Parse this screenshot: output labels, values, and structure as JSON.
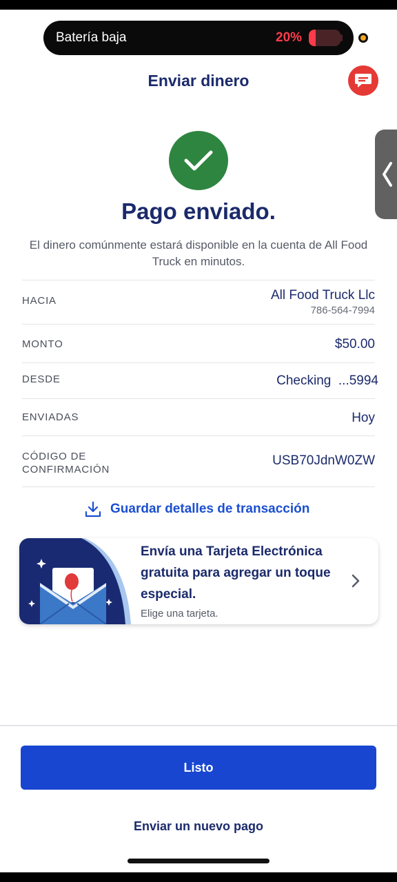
{
  "status": {
    "battery_label": "Batería baja",
    "battery_percent_text": "20%",
    "battery_level": 0.2,
    "battery_color": "#ff3b4b"
  },
  "header": {
    "title": "Enviar dinero",
    "chat_icon": "chat-bubble-icon"
  },
  "success": {
    "icon": "checkmark-icon",
    "title": "Pago enviado.",
    "message": "El dinero comúnmente estará disponible en la cuenta de All Food Truck en minutos."
  },
  "details": {
    "to_label": "HACIA",
    "to_name": "All Food Truck Llc",
    "to_phone": "786-564-7994",
    "amount_label": "MONTO",
    "amount_value": "$50.00",
    "from_label": "DESDE",
    "from_value": "Checking  ...5994",
    "sent_label": "ENVIADAS",
    "sent_value": "Hoy",
    "confirmation_label": "CÓDIGO DE CONFIRMACIÓN",
    "confirmation_value": "USB70JdnW0ZW"
  },
  "save_link": {
    "label": "Guardar detalles de transacción",
    "icon": "download-icon"
  },
  "promo": {
    "title": "Envía una Tarjeta Electrónica gratuita para agregar un toque especial.",
    "subtitle": "Elige una tarjeta.",
    "icon": "chevron-right-icon"
  },
  "footer": {
    "primary_label": "Listo",
    "secondary_label": "Enviar un nuevo pago"
  },
  "colors": {
    "brand_navy": "#1b2a6b",
    "primary_blue": "#1946d1",
    "success_green": "#2e8540",
    "alert_red": "#e53935"
  }
}
